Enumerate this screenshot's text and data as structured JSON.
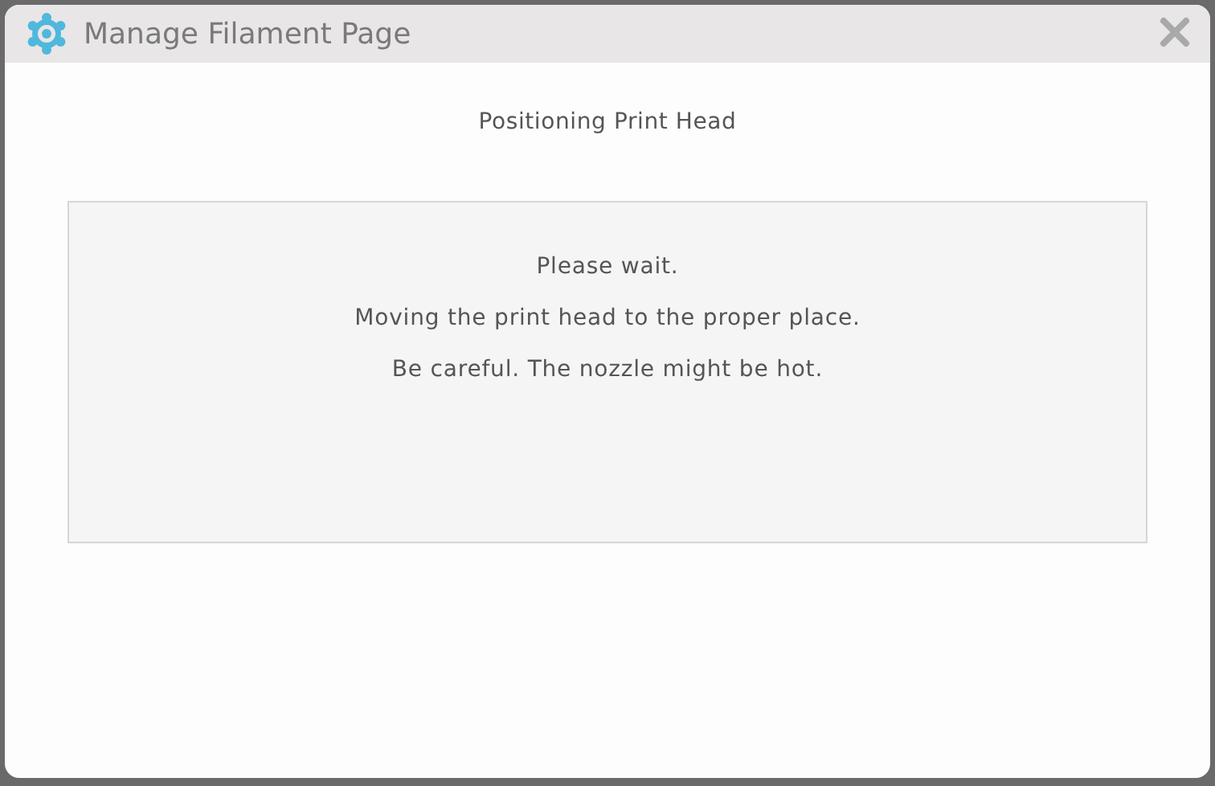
{
  "window": {
    "title": "Manage Filament Page"
  },
  "heading": "Positioning Print Head",
  "message_lines": [
    "Please wait.",
    "Moving the print head to the proper place.",
    "Be careful. The nozzle might be hot."
  ]
}
